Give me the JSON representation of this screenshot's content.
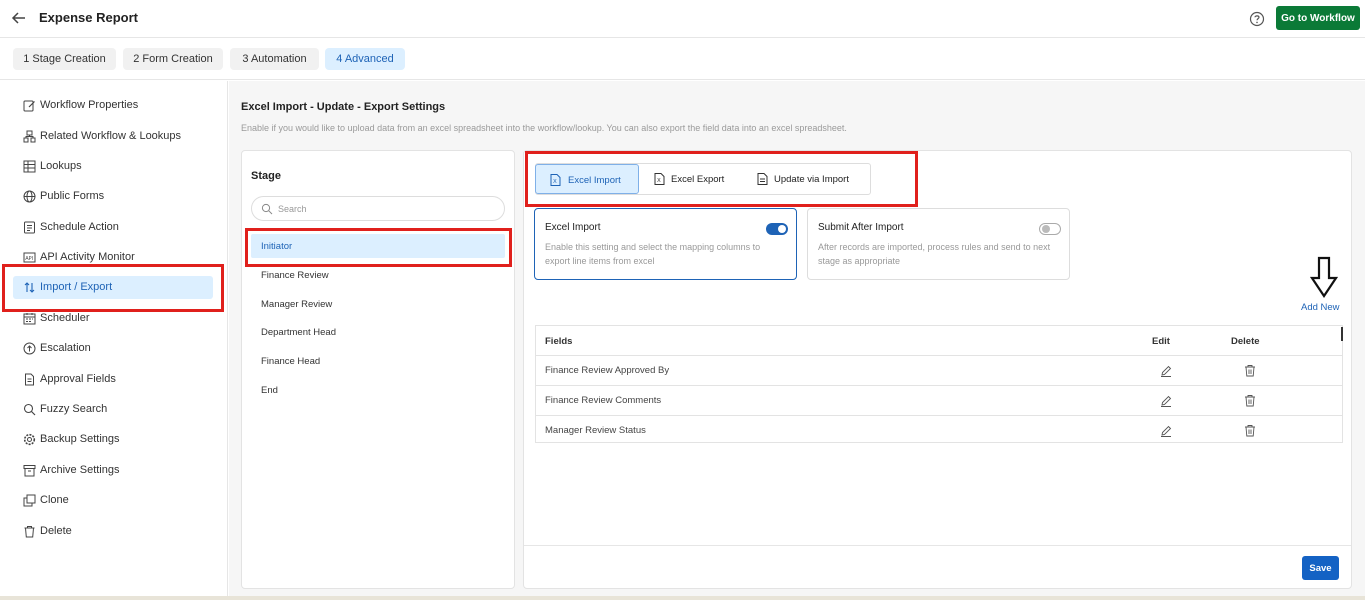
{
  "header": {
    "title": "Expense Report",
    "workflow_button": "Go to Workflow",
    "accent": "#0b7a37"
  },
  "steps": [
    {
      "label": "1  Stage Creation",
      "active": false
    },
    {
      "label": "2  Form Creation",
      "active": false
    },
    {
      "label": "3  Automation",
      "active": false
    },
    {
      "label": "4  Advanced",
      "active": true
    }
  ],
  "sidebar": {
    "items": [
      {
        "label": "Workflow Properties",
        "icon": "edit-icon"
      },
      {
        "label": "Related Workflow & Lookups",
        "icon": "hierarchy-icon"
      },
      {
        "label": "Lookups",
        "icon": "table-icon"
      },
      {
        "label": "Public Forms",
        "icon": "globe-icon"
      },
      {
        "label": "Schedule Action",
        "icon": "schedule-icon"
      },
      {
        "label": "API Activity Monitor",
        "icon": "api-icon"
      },
      {
        "label": "Import / Export",
        "icon": "import-export-icon",
        "active": true
      },
      {
        "label": "Scheduler",
        "icon": "calendar-icon"
      },
      {
        "label": "Escalation",
        "icon": "escalation-icon"
      },
      {
        "label": "Approval Fields",
        "icon": "document-icon"
      },
      {
        "label": "Fuzzy Search",
        "icon": "search-icon"
      },
      {
        "label": "Backup Settings",
        "icon": "gear-icon"
      },
      {
        "label": "Archive Settings",
        "icon": "archive-icon"
      },
      {
        "label": "Clone",
        "icon": "clone-icon"
      },
      {
        "label": "Delete",
        "icon": "trash-icon"
      }
    ]
  },
  "section": {
    "title": "Excel Import - Update - Export Settings",
    "description": "Enable if you would like to upload data from an excel spreadsheet into the workflow/lookup. You can also export the field data into an excel spreadsheet."
  },
  "stage": {
    "heading": "Stage",
    "search_placeholder": "Search",
    "items": [
      "Initiator",
      "Finance Review",
      "Manager Review",
      "Department Head",
      "Finance Head",
      "End"
    ],
    "active_index": 0
  },
  "mode_tabs": [
    {
      "label": "Excel Import",
      "active": true
    },
    {
      "label": "Excel Export",
      "active": false
    },
    {
      "label": "Update via Import",
      "active": false
    }
  ],
  "cards": [
    {
      "title": "Excel Import",
      "description": "Enable this setting and select the mapping columns to export line items from excel",
      "enabled": true
    },
    {
      "title": "Submit After Import",
      "description": "After records are imported, process rules and send to next stage as appropriate",
      "enabled": false
    }
  ],
  "add_new_label": "Add New",
  "table": {
    "headers": {
      "fields": "Fields",
      "edit": "Edit",
      "delete": "Delete"
    },
    "rows": [
      "Finance Review Approved By",
      "Finance Review Comments",
      "Manager Review Status"
    ]
  },
  "save_label": "Save",
  "colors": {
    "highlight": "#e0201c",
    "primary": "#1e63b6",
    "active_bg": "#dcefff"
  }
}
